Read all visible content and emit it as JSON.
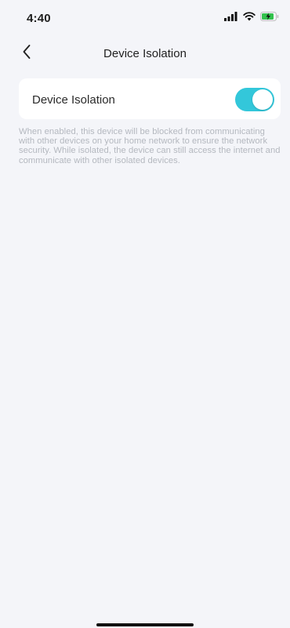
{
  "status_bar": {
    "time": "4:40",
    "icons": [
      "cellular-signal-icon",
      "wifi-icon",
      "battery-charging-icon"
    ],
    "battery_color": "#33c24d"
  },
  "nav": {
    "back_icon": "chevron-left-icon",
    "title": "Device Isolation"
  },
  "setting": {
    "label": "Device Isolation",
    "toggle_on": true,
    "toggle_color": "#33c7da"
  },
  "description": "When enabled, this device will be blocked from communicating with other devices on your home network to ensure the network security. While isolated, the device can still access the internet and communicate with other isolated devices."
}
